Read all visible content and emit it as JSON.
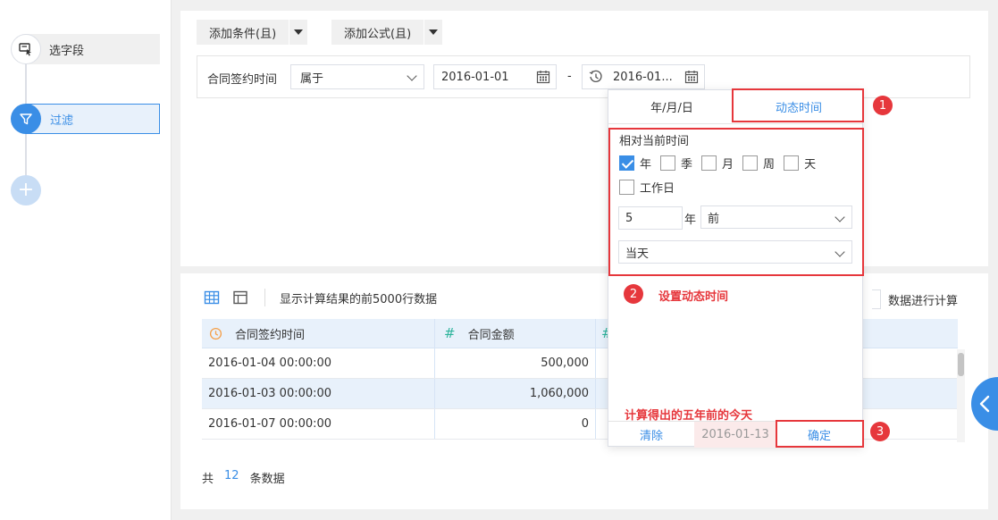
{
  "steps": [
    {
      "label": "选字段",
      "icon": "select-field-icon"
    },
    {
      "label": "过滤",
      "icon": "filter-icon"
    },
    {
      "label": "+",
      "icon": "add-step-icon"
    }
  ],
  "top": {
    "add_condition": "添加条件(且)",
    "add_formula": "添加公式(且)",
    "filter_field": "合同签约时间",
    "operator": "属于",
    "start_date": "2016-01-01",
    "separator": "-",
    "end_date": "2016-01..."
  },
  "popup": {
    "tab_ymd": "年/月/日",
    "tab_dynamic": "动态时间",
    "relative_label": "相对当前时间",
    "units": [
      {
        "label": "年",
        "checked": true
      },
      {
        "label": "季",
        "checked": false
      },
      {
        "label": "月",
        "checked": false
      },
      {
        "label": "周",
        "checked": false
      },
      {
        "label": "天",
        "checked": false
      }
    ],
    "workday": {
      "label": "工作日",
      "checked": false
    },
    "offset_value": "5",
    "offset_unit": "年",
    "direction": "前",
    "anchor": "当天",
    "clear": "清除",
    "result_date": "2016-01-13",
    "confirm": "确定"
  },
  "annotations": {
    "badge1": "1",
    "badge2": "2",
    "badge3": "3",
    "set_dynamic": "设置动态时间",
    "result_note": "计算得出的五年前的今天"
  },
  "data_panel": {
    "preview_note": "显示计算结果的前5000行数据",
    "calc_note": "数据进行计算",
    "columns": [
      {
        "name": "合同签约时间",
        "type_icon": "clock-icon"
      },
      {
        "name": "合同金额",
        "type_icon": "hash-icon"
      },
      {
        "name": "",
        "type_icon": "hash-icon"
      }
    ],
    "rows": [
      [
        "2016-01-04 00:00:00",
        "500,000",
        ""
      ],
      [
        "2016-01-03 00:00:00",
        "1,060,000",
        ""
      ],
      [
        "2016-01-07 00:00:00",
        "0",
        ""
      ]
    ],
    "count_prefix": "共",
    "count": "12",
    "count_suffix": "条数据"
  },
  "colors": {
    "accent": "#3a8ee6",
    "annotation": "#e6373c"
  }
}
